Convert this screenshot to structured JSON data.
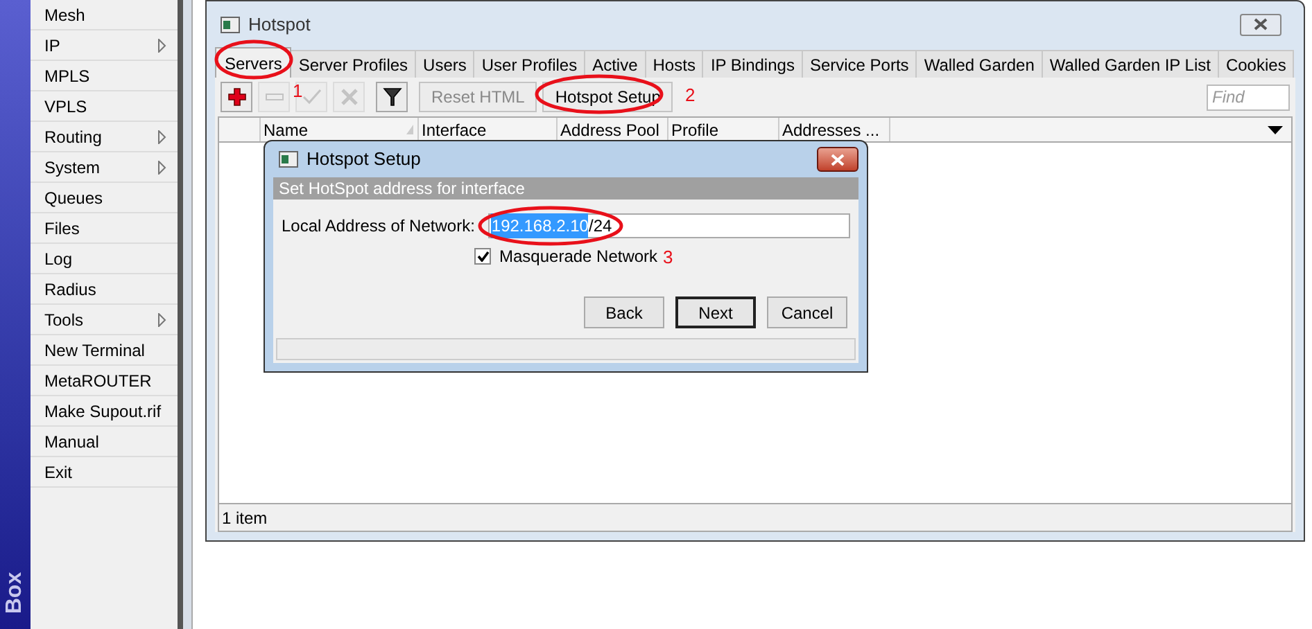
{
  "sidebar": {
    "brand": "Box",
    "items": [
      {
        "label": "Mesh",
        "submenu": false
      },
      {
        "label": "IP",
        "submenu": true
      },
      {
        "label": "MPLS",
        "submenu": false
      },
      {
        "label": "VPLS",
        "submenu": false
      },
      {
        "label": "Routing",
        "submenu": true
      },
      {
        "label": "System",
        "submenu": true
      },
      {
        "label": "Queues",
        "submenu": false
      },
      {
        "label": "Files",
        "submenu": false
      },
      {
        "label": "Log",
        "submenu": false
      },
      {
        "label": "Radius",
        "submenu": false
      },
      {
        "label": "Tools",
        "submenu": true
      },
      {
        "label": "New Terminal",
        "submenu": false
      },
      {
        "label": "MetaROUTER",
        "submenu": false
      },
      {
        "label": "Make Supout.rif",
        "submenu": false
      },
      {
        "label": "Manual",
        "submenu": false
      },
      {
        "label": "Exit",
        "submenu": false
      }
    ]
  },
  "window": {
    "title": "Hotspot",
    "tabs": [
      {
        "label": "Servers",
        "selected": true
      },
      {
        "label": "Server Profiles",
        "selected": false
      },
      {
        "label": "Users",
        "selected": false
      },
      {
        "label": "User Profiles",
        "selected": false
      },
      {
        "label": "Active",
        "selected": false
      },
      {
        "label": "Hosts",
        "selected": false
      },
      {
        "label": "IP Bindings",
        "selected": false
      },
      {
        "label": "Service Ports",
        "selected": false
      },
      {
        "label": "Walled Garden",
        "selected": false
      },
      {
        "label": "Walled Garden IP List",
        "selected": false
      },
      {
        "label": "Cookies",
        "selected": false
      }
    ],
    "toolbar": [
      {
        "kind": "add",
        "disabled": false
      },
      {
        "kind": "remove",
        "disabled": true
      },
      {
        "kind": "enable",
        "disabled": true
      },
      {
        "kind": "disable",
        "disabled": true
      },
      {
        "kind": "filter",
        "disabled": false
      },
      {
        "kind": "text",
        "label": "Reset HTML",
        "disabled": true
      },
      {
        "kind": "text",
        "label": "Hotspot Setup",
        "disabled": false
      }
    ],
    "search": {
      "placeholder": "Find"
    },
    "table": {
      "columns": [
        {
          "label": "Name",
          "sorted": true
        },
        {
          "label": "Interface",
          "sorted": false
        },
        {
          "label": "Address Pool",
          "sorted": false
        },
        {
          "label": "Profile",
          "sorted": false
        },
        {
          "label": "Addresses ...",
          "sorted": false
        }
      ]
    },
    "status_bar": "1 item"
  },
  "dialog": {
    "title": "Hotspot Setup",
    "banner": "Set HotSpot address for interface",
    "field_label": "Local Address of Network:",
    "value_parts": [
      {
        "text": "192.168.2.10",
        "selected": true
      },
      {
        "text": "/24",
        "selected": false
      }
    ],
    "checkbox": {
      "label": "Masquerade Network",
      "checked": true
    },
    "buttons": [
      {
        "label": "Back",
        "default": false
      },
      {
        "label": "Next",
        "default": true
      },
      {
        "label": "Cancel",
        "default": false
      }
    ]
  },
  "annotations": [
    "1",
    "2",
    "3"
  ]
}
